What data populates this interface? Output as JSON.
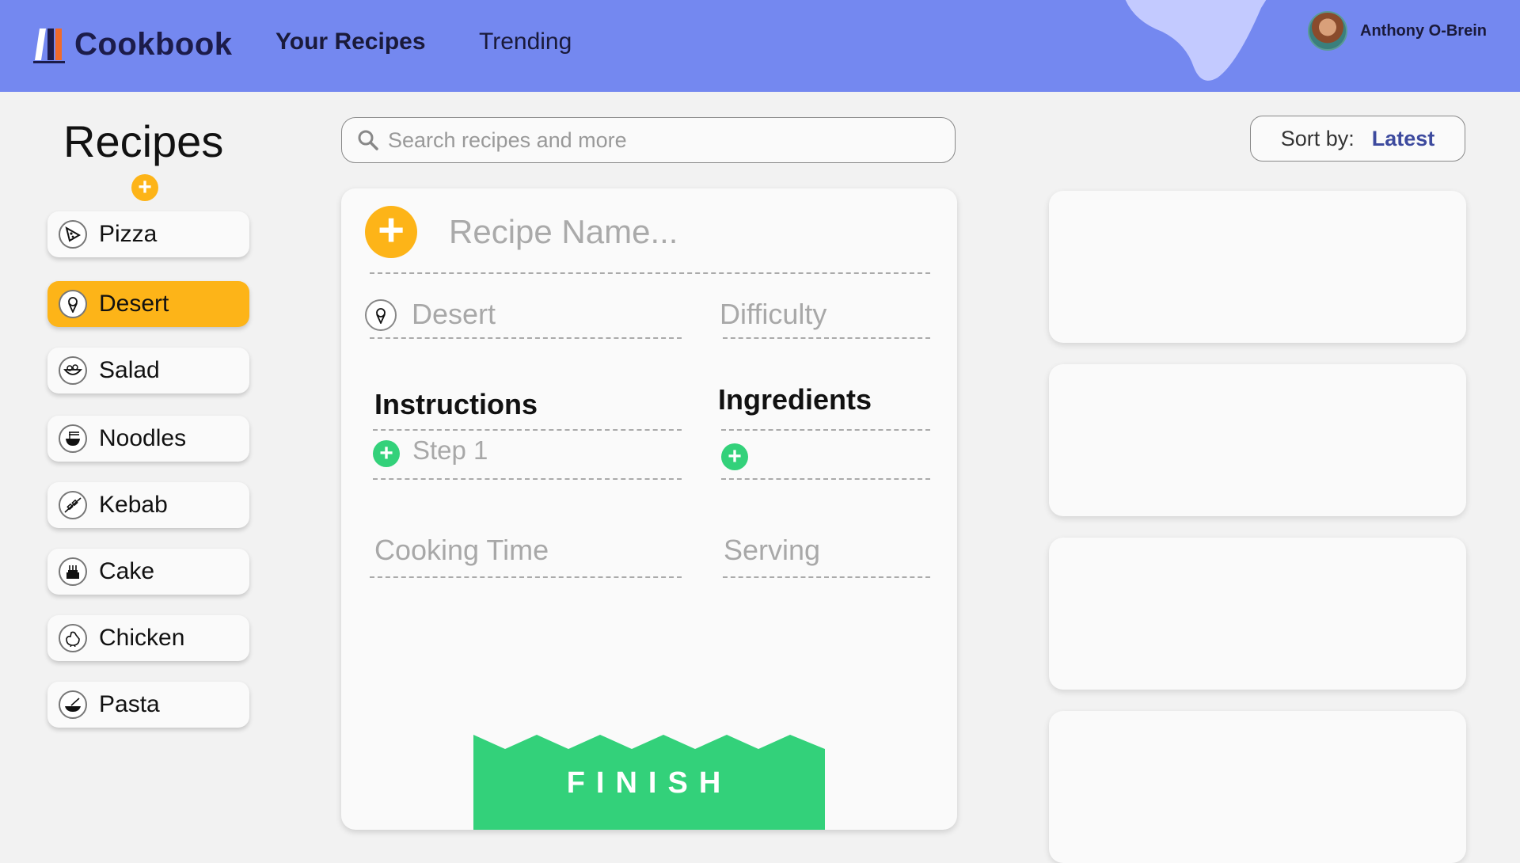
{
  "header": {
    "app_name": "Cookbook",
    "nav": {
      "your_recipes": "Your Recipes",
      "trending": "Trending"
    },
    "user": {
      "name": "Anthony O-Brein"
    },
    "colors": {
      "bar": "#7488f0",
      "blob": "#c3caff"
    }
  },
  "sidebar": {
    "title": "Recipes",
    "add_label": "+",
    "items": [
      {
        "label": "Pizza",
        "icon": "pizza-icon",
        "active": false
      },
      {
        "label": "Desert",
        "icon": "ice-cream-icon",
        "active": true
      },
      {
        "label": "Salad",
        "icon": "salad-icon",
        "active": false
      },
      {
        "label": "Noodles",
        "icon": "noodles-icon",
        "active": false
      },
      {
        "label": "Kebab",
        "icon": "kebab-icon",
        "active": false
      },
      {
        "label": "Cake",
        "icon": "cake-icon",
        "active": false
      },
      {
        "label": "Chicken",
        "icon": "chicken-icon",
        "active": false
      },
      {
        "label": "Pasta",
        "icon": "pasta-icon",
        "active": false
      }
    ]
  },
  "search": {
    "placeholder": "Search recipes and more"
  },
  "sort": {
    "label": "Sort by:",
    "value": "Latest"
  },
  "editor": {
    "add_label": "+",
    "name_placeholder": "Recipe Name...",
    "category": "Desert",
    "difficulty": "Difficulty",
    "instructions_title": "Instructions",
    "ingredients_title": "Ingredients",
    "step_label": "Step 1",
    "add_step_label": "+",
    "add_ingredient_label": "+",
    "cooking_time": "Cooking Time",
    "serving": "Serving",
    "finish_label": "FINISH"
  },
  "colors": {
    "accent": "#fdb418",
    "green": "#33d17a",
    "sort_value": "#3d4a9e"
  }
}
